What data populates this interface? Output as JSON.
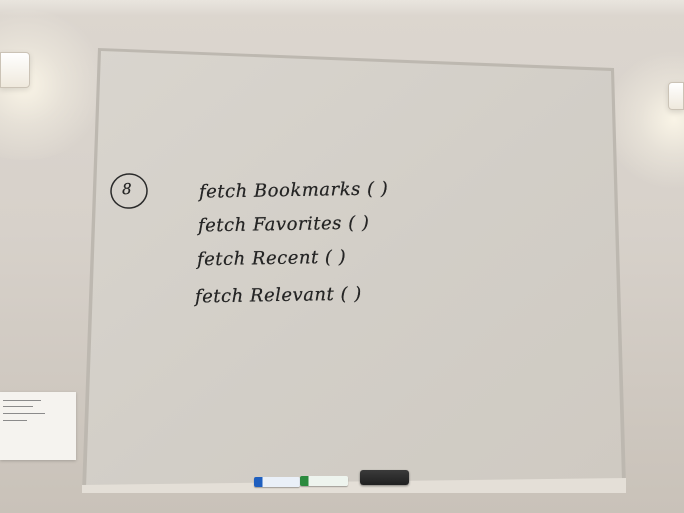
{
  "board": {
    "circle_number": "8",
    "lines": [
      "fetch Bookmarks ( )",
      "fetch Favorites ( )",
      "fetch Recent ( )",
      "fetch Relevant ( )"
    ]
  },
  "markers": [
    {
      "name": "blue-marker",
      "color": "#1f5fbf"
    },
    {
      "name": "green-marker",
      "color": "#2b8a3e"
    }
  ],
  "eraser": {
    "color": "#2a2a2a"
  }
}
